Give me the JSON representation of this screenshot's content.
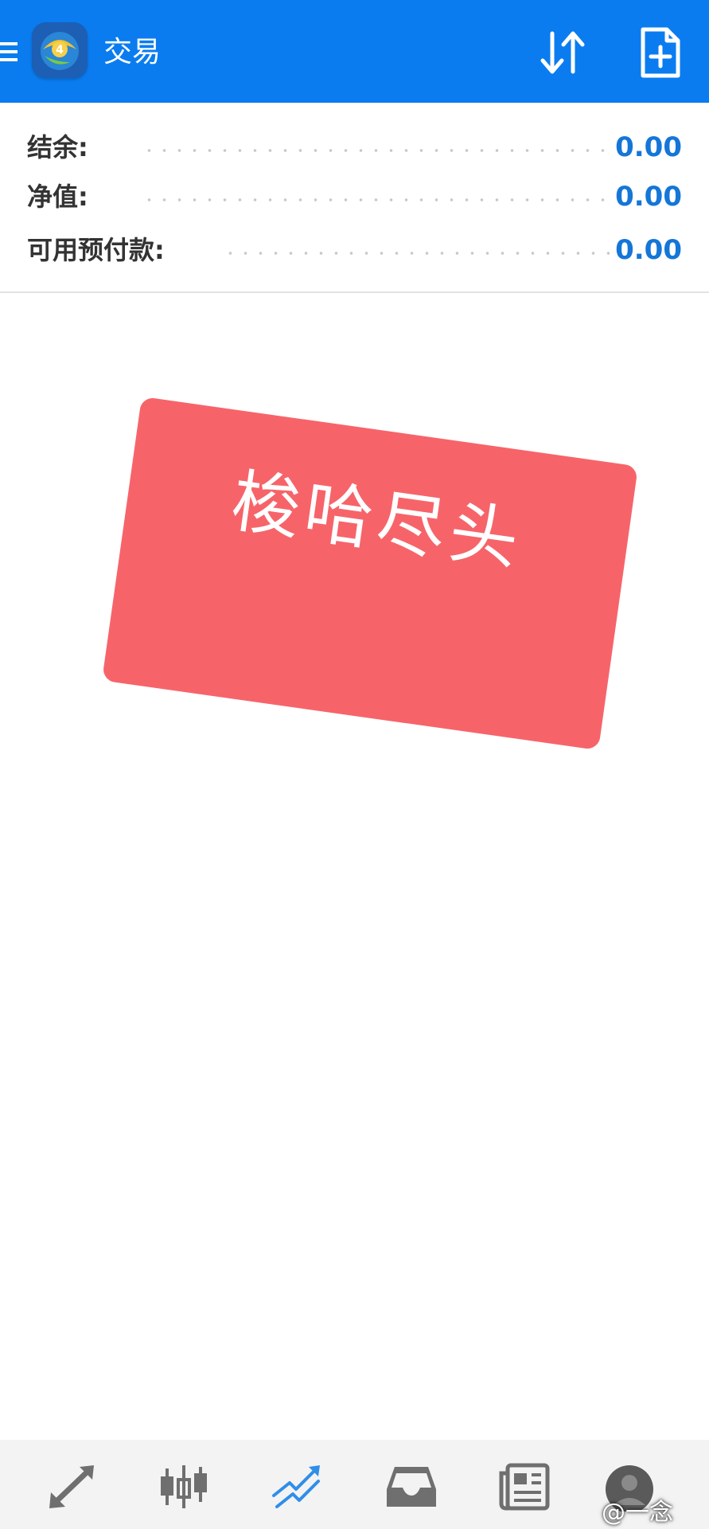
{
  "header": {
    "title": "交易",
    "menu_icon": "menu-icon",
    "app_logo_icon": "metatrader-logo-icon",
    "sort_icon": "sort-arrows-icon",
    "new_order_icon": "new-document-plus-icon",
    "accent_color": "#0a7cf0"
  },
  "summary": {
    "rows": [
      {
        "label": "结余:",
        "value": "0.00"
      },
      {
        "label": "净值:",
        "value": "0.00"
      },
      {
        "label": "可用预付款:",
        "value": "0.00"
      }
    ],
    "value_color": "#1476d8"
  },
  "stamp": {
    "text": "梭哈尽头",
    "color": "#f6646a"
  },
  "bottom_nav": {
    "items": [
      {
        "icon": "quotes-arrows-icon",
        "active": false
      },
      {
        "icon": "candlestick-chart-icon",
        "active": false
      },
      {
        "icon": "trade-trend-icon",
        "active": true
      },
      {
        "icon": "history-inbox-icon",
        "active": false
      },
      {
        "icon": "news-icon",
        "active": false
      },
      {
        "icon": "avatar-icon",
        "active": false
      }
    ],
    "active_color": "#2f8ee8",
    "inactive_color": "#6f6f6f"
  },
  "watermark": {
    "text": "@一念"
  }
}
